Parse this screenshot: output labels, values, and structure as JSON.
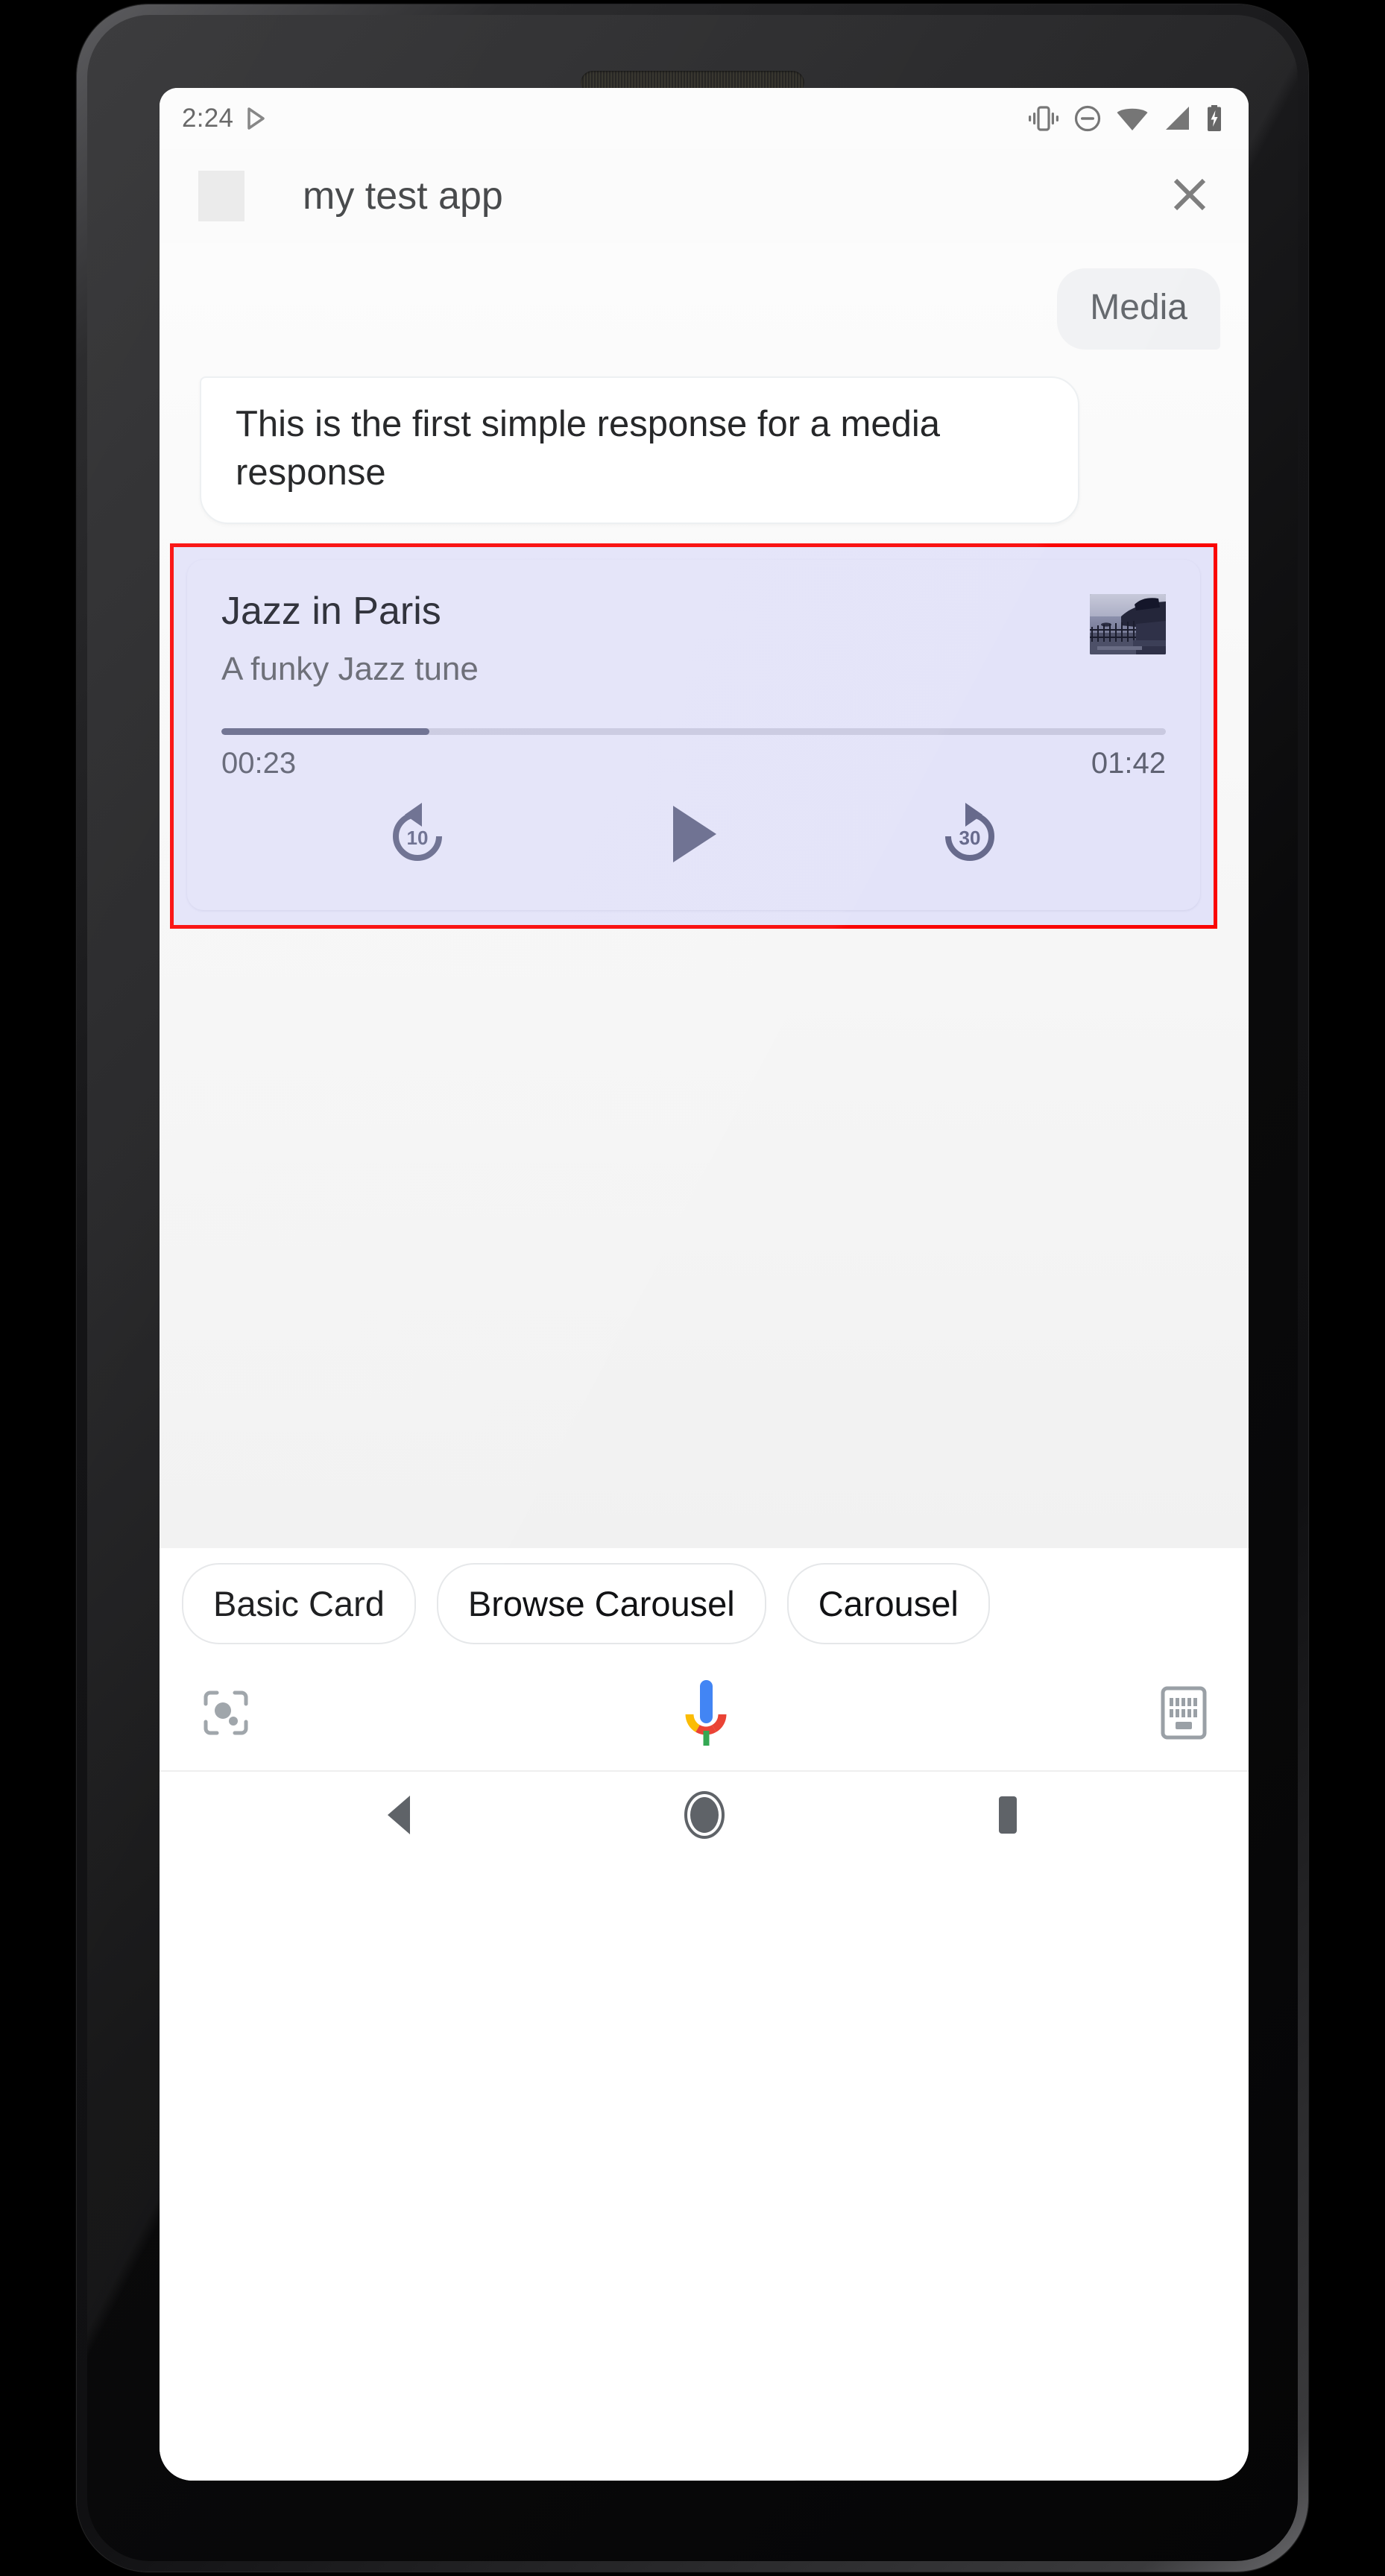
{
  "status_bar": {
    "time": "2:24",
    "icons": [
      {
        "name": "play-arrow-icon",
        "label": "media playing"
      },
      {
        "name": "vibrate-icon",
        "label": "vibrate mode"
      },
      {
        "name": "do-not-disturb-icon",
        "label": "do not disturb"
      },
      {
        "name": "wifi-icon",
        "label": "wifi full"
      },
      {
        "name": "cellular-signal-icon",
        "label": "cellular signal"
      },
      {
        "name": "battery-charging-icon",
        "label": "battery charging"
      }
    ]
  },
  "header": {
    "app_icon_label": "app-icon-placeholder",
    "title": "my test app",
    "close_label": "close-icon"
  },
  "conversation": {
    "user_message": "Media",
    "agent_message": "This is the first simple response for a media response"
  },
  "media_card": {
    "highlighted": true,
    "highlight_color": "#fa0505",
    "background_color": "#e3e3f9",
    "title": "Jazz in Paris",
    "subtitle": "A funky Jazz tune",
    "album_art_label": "album-art-coastal-fence-photo",
    "progress_percent": 22,
    "current_time": "00:23",
    "total_time": "01:42",
    "controls": [
      {
        "name": "replay-10-icon",
        "label": "10"
      },
      {
        "name": "play-icon",
        "label": "Play"
      },
      {
        "name": "forward-30-icon",
        "label": "30"
      }
    ]
  },
  "suggestion_chips": [
    {
      "label": "Basic Card"
    },
    {
      "label": "Browse Carousel"
    },
    {
      "label": "Carousel"
    }
  ],
  "assistant_bar": {
    "lens_icon": "google-lens-icon",
    "mic_icon": "assistant-mic-icon",
    "keyboard_icon": "keyboard-icon",
    "mic_colors": {
      "blue": "#4285f4",
      "red": "#ea4335",
      "yellow": "#fbbc05",
      "green": "#34a853"
    }
  },
  "nav_bar": {
    "back_label": "back-icon",
    "home_label": "home-icon",
    "recents_label": "recents-icon"
  }
}
